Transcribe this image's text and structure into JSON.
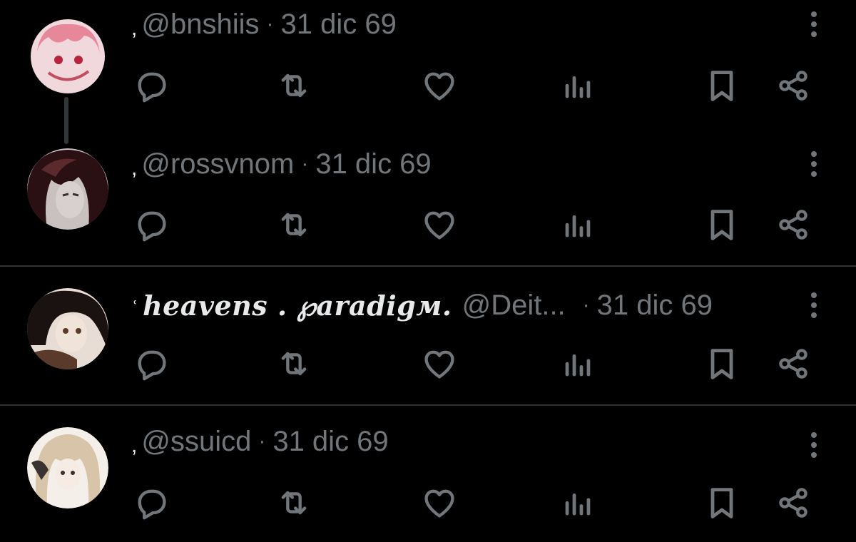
{
  "theme": {
    "background": "#000000",
    "text_primary": "#e7e9ea",
    "text_secondary": "#71767b",
    "divider": "#2f3336"
  },
  "posts": [
    {
      "prefix": ",",
      "display_name": "",
      "handle": "@bnshiis",
      "separator": "·",
      "time": "31 dic 69",
      "avatar_icon": "user-avatar-pink-hair",
      "avatar_colors": [
        "#f0d8dc",
        "#e7879a",
        "#b8243a"
      ]
    },
    {
      "prefix": ",",
      "display_name": "",
      "handle": "@rossvnom",
      "separator": "·",
      "time": "31 dic 69",
      "avatar_icon": "user-avatar-dark-hair",
      "avatar_colors": [
        "#2a1012",
        "#5a2a2c",
        "#c9c1c0"
      ]
    },
    {
      "prefix": "ʿ",
      "display_name": "ℎeavens . ℘aradigм.",
      "handle": "@Deit...",
      "separator": "·",
      "time": "31 dic 69",
      "avatar_icon": "user-avatar-brown-hair",
      "avatar_colors": [
        "#1a1210",
        "#5a3a2a",
        "#e8ddd4"
      ]
    },
    {
      "prefix": ",",
      "display_name": "",
      "handle": "@ssuicd",
      "separator": "·",
      "time": "31 dic 69",
      "avatar_icon": "user-avatar-blonde-hair",
      "avatar_colors": [
        "#f4efe9",
        "#d8c4a8",
        "#3a3230"
      ]
    }
  ],
  "action_icons": [
    "reply-icon",
    "retweet-icon",
    "like-icon",
    "views-icon",
    "bookmark-icon",
    "share-icon"
  ],
  "more_icon": "more-options-icon"
}
